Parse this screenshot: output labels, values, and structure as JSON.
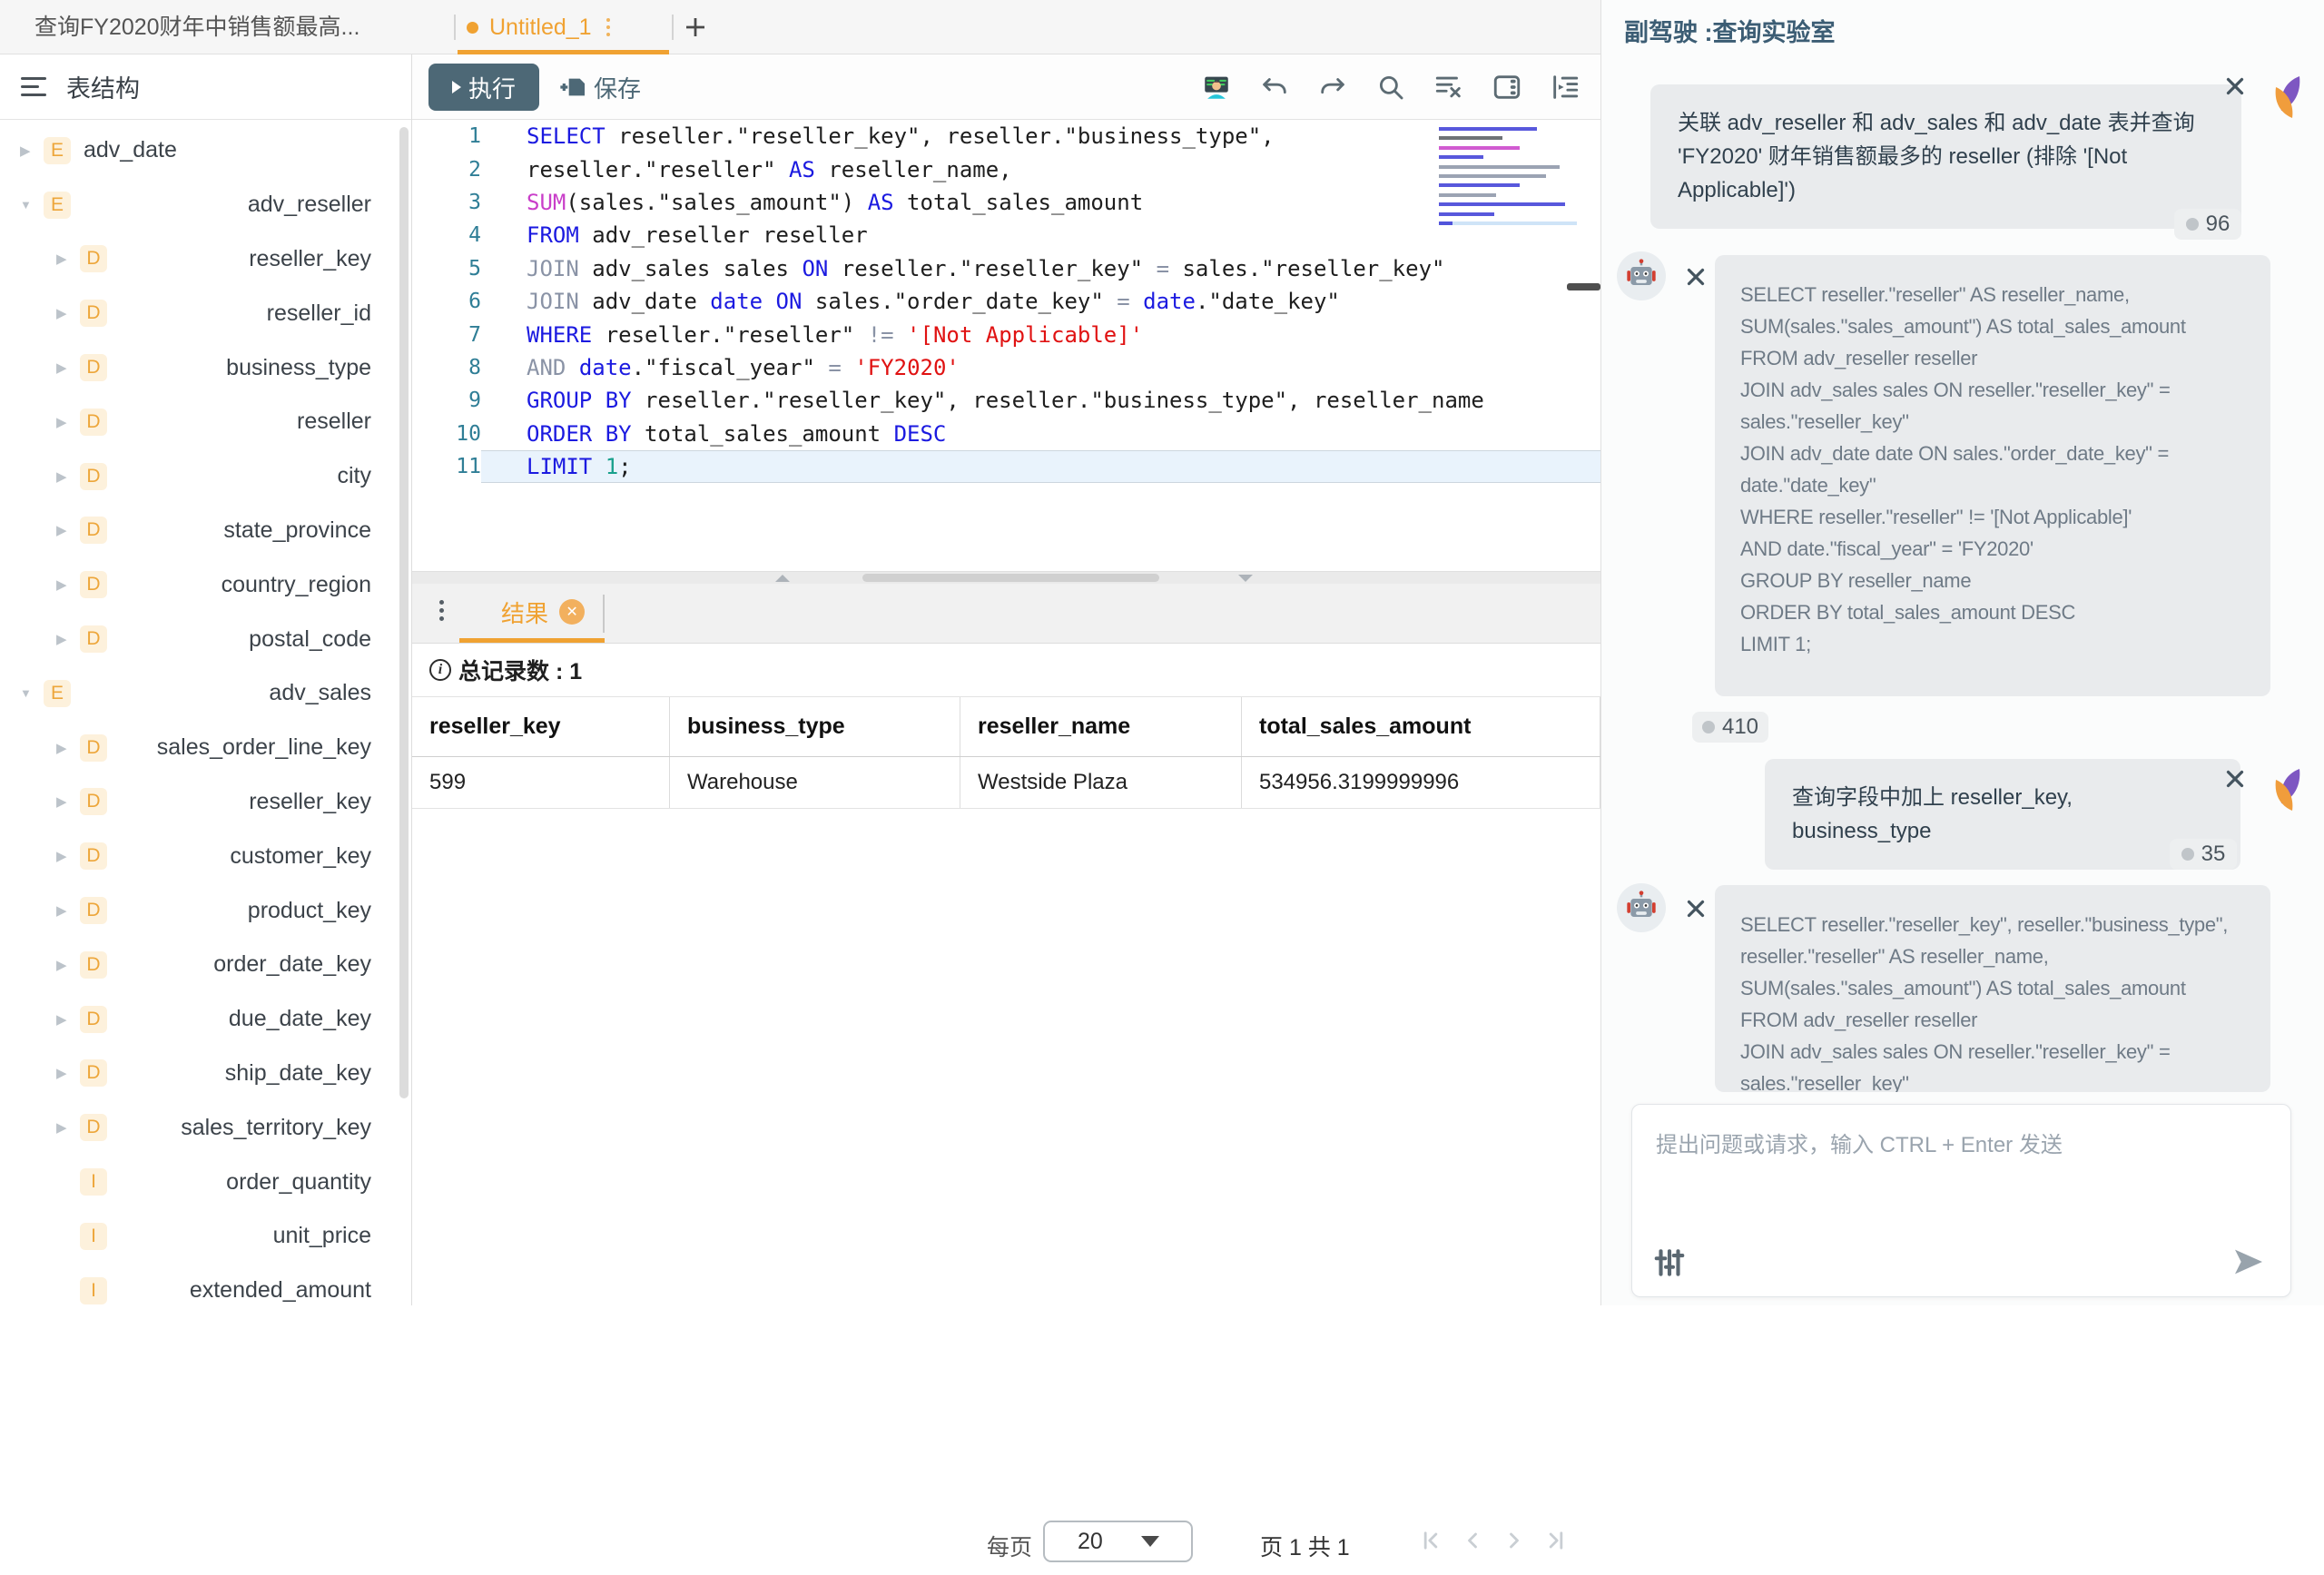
{
  "colors": {
    "accent_orange": "#f0a232",
    "slate": "#4d6876",
    "copilot_title": "#3c5d74",
    "syntax_keyword": "#1b1ae0",
    "syntax_secondary": "#8a93a6",
    "syntax_function": "#c93ec9",
    "syntax_string": "#e01212",
    "syntax_number": "#18a08c",
    "line_number": "#2f7e96"
  },
  "tabs": {
    "tab1_label": "查询FY2020财年中销售额最高...",
    "tab2_label": "Untitled_1",
    "new_tab_label": "+"
  },
  "sidebar": {
    "title": "表结构",
    "tree": [
      {
        "label": "adv_date",
        "badge": "E",
        "level": 0,
        "expanded": false,
        "align": "left",
        "arrow": true
      },
      {
        "label": "adv_reseller",
        "badge": "E",
        "level": 0,
        "expanded": true,
        "align": "right",
        "arrow": true
      },
      {
        "label": "reseller_key",
        "badge": "D",
        "level": 1,
        "arrow": true
      },
      {
        "label": "reseller_id",
        "badge": "D",
        "level": 1,
        "arrow": true
      },
      {
        "label": "business_type",
        "badge": "D",
        "level": 1,
        "arrow": true
      },
      {
        "label": "reseller",
        "badge": "D",
        "level": 1,
        "arrow": true
      },
      {
        "label": "city",
        "badge": "D",
        "level": 1,
        "arrow": true
      },
      {
        "label": "state_province",
        "badge": "D",
        "level": 1,
        "arrow": true
      },
      {
        "label": "country_region",
        "badge": "D",
        "level": 1,
        "arrow": true
      },
      {
        "label": "postal_code",
        "badge": "D",
        "level": 1,
        "arrow": true
      },
      {
        "label": "adv_sales",
        "badge": "E",
        "level": 0,
        "expanded": true,
        "align": "right",
        "arrow": true
      },
      {
        "label": "sales_order_line_key",
        "badge": "D",
        "level": 1,
        "arrow": true
      },
      {
        "label": "reseller_key",
        "badge": "D",
        "level": 1,
        "arrow": true
      },
      {
        "label": "customer_key",
        "badge": "D",
        "level": 1,
        "arrow": true
      },
      {
        "label": "product_key",
        "badge": "D",
        "level": 1,
        "arrow": true
      },
      {
        "label": "order_date_key",
        "badge": "D",
        "level": 1,
        "arrow": true
      },
      {
        "label": "due_date_key",
        "badge": "D",
        "level": 1,
        "arrow": true
      },
      {
        "label": "ship_date_key",
        "badge": "D",
        "level": 1,
        "arrow": true
      },
      {
        "label": "sales_territory_key",
        "badge": "D",
        "level": 1,
        "arrow": true
      },
      {
        "label": "order_quantity",
        "badge": "I",
        "level": 1,
        "arrow": false
      },
      {
        "label": "unit_price",
        "badge": "I",
        "level": 1,
        "arrow": false
      },
      {
        "label": "extended_amount",
        "badge": "I",
        "level": 1,
        "arrow": false
      }
    ]
  },
  "toolbar": {
    "run_label": "执行",
    "save_label": "保存",
    "icons": [
      "technologist-icon",
      "undo-icon",
      "redo-icon",
      "search-icon",
      "clear-format-icon",
      "panel-icon",
      "indent-icon"
    ]
  },
  "editor": {
    "lines": [
      {
        "num": "1",
        "segs": [
          [
            "kw",
            "SELECT"
          ],
          [
            "pl",
            " reseller.\"reseller_key\", reseller.\"business_type\","
          ]
        ]
      },
      {
        "num": "2",
        "segs": [
          [
            "pl",
            "reseller.\"reseller\" "
          ],
          [
            "kw",
            "AS"
          ],
          [
            "pl",
            " reseller_name,"
          ]
        ]
      },
      {
        "num": "3",
        "segs": [
          [
            "fn",
            "SUM"
          ],
          [
            "pl",
            "(sales.\"sales_amount\") "
          ],
          [
            "kw",
            "AS"
          ],
          [
            "pl",
            " total_sales_amount"
          ]
        ]
      },
      {
        "num": "4",
        "segs": [
          [
            "kw",
            "FROM"
          ],
          [
            "pl",
            " adv_reseller reseller"
          ]
        ]
      },
      {
        "num": "5",
        "segs": [
          [
            "kw2",
            "JOIN"
          ],
          [
            "pl",
            " adv_sales sales "
          ],
          [
            "kw",
            "ON"
          ],
          [
            "pl",
            " reseller.\"reseller_key\" "
          ],
          [
            "kw2",
            "="
          ],
          [
            "pl",
            " sales.\"reseller_key\""
          ]
        ]
      },
      {
        "num": "6",
        "segs": [
          [
            "kw2",
            "JOIN"
          ],
          [
            "pl",
            " adv_date "
          ],
          [
            "kw",
            "date"
          ],
          [
            "pl",
            " "
          ],
          [
            "kw",
            "ON"
          ],
          [
            "pl",
            " sales.\"order_date_key\" "
          ],
          [
            "kw2",
            "="
          ],
          [
            "pl",
            " "
          ],
          [
            "kw",
            "date"
          ],
          [
            "pl",
            ".\"date_key\""
          ]
        ]
      },
      {
        "num": "7",
        "segs": [
          [
            "kw",
            "WHERE"
          ],
          [
            "pl",
            " reseller.\"reseller\" "
          ],
          [
            "kw2",
            "!="
          ],
          [
            "pl",
            " "
          ],
          [
            "str",
            "'[Not Applicable]'"
          ]
        ]
      },
      {
        "num": "8",
        "segs": [
          [
            "kw2",
            "AND"
          ],
          [
            "pl",
            " "
          ],
          [
            "kw",
            "date"
          ],
          [
            "pl",
            ".\"fiscal_year\" "
          ],
          [
            "kw2",
            "="
          ],
          [
            "pl",
            " "
          ],
          [
            "str",
            "'FY2020'"
          ]
        ]
      },
      {
        "num": "9",
        "segs": [
          [
            "kw",
            "GROUP BY"
          ],
          [
            "pl",
            " reseller.\"reseller_key\", reseller.\"business_type\", reseller_name"
          ]
        ]
      },
      {
        "num": "10",
        "segs": [
          [
            "kw",
            "ORDER BY"
          ],
          [
            "pl",
            " total_sales_amount "
          ],
          [
            "kw",
            "DESC"
          ]
        ]
      },
      {
        "num": "11",
        "segs": [
          [
            "kw",
            "LIMIT"
          ],
          [
            "pl",
            " "
          ],
          [
            "num",
            "1"
          ],
          [
            "pl",
            ";"
          ]
        ],
        "current": true
      }
    ]
  },
  "results": {
    "tab_label": "结果",
    "total_label": "总记录数 : 1",
    "columns": [
      "reseller_key",
      "business_type",
      "reseller_name",
      "total_sales_amount"
    ],
    "rows": [
      [
        "599",
        "Warehouse",
        "Westside Plaza",
        "534956.3199999996"
      ]
    ]
  },
  "pagination": {
    "per_page_label": "每页",
    "per_page_value": "20",
    "page_info": "页 1 共 1",
    "nav_icons": [
      "first-page-icon",
      "prev-page-icon",
      "next-page-icon",
      "last-page-icon"
    ]
  },
  "copilot": {
    "title": "副驾驶 :查询实验室",
    "messages": [
      {
        "role": "user",
        "tokens": "96",
        "text": "关联 adv_reseller 和 adv_sales 和 adv_date 表并查询 'FY2020' 财年销售额最多的 reseller (排除 '[Not Applicable]')"
      },
      {
        "role": "assistant",
        "tokens": "410",
        "text": "SELECT reseller.\"reseller\" AS reseller_name,\nSUM(sales.\"sales_amount\") AS total_sales_amount\nFROM adv_reseller reseller\nJOIN adv_sales sales ON reseller.\"reseller_key\" = sales.\"reseller_key\"\nJOIN adv_date date ON sales.\"order_date_key\" = date.\"date_key\"\nWHERE reseller.\"reseller\" != '[Not Applicable]'\nAND date.\"fiscal_year\" = 'FY2020'\nGROUP BY reseller_name\nORDER BY total_sales_amount DESC\nLIMIT 1;"
      },
      {
        "role": "user",
        "tokens": "35",
        "text": "查询字段中加上 reseller_key, business_type"
      },
      {
        "role": "assistant",
        "tokens": null,
        "text": "SELECT reseller.\"reseller_key\", reseller.\"business_type\",\nreseller.\"reseller\" AS reseller_name,\nSUM(sales.\"sales_amount\") AS total_sales_amount\nFROM adv_reseller reseller\nJOIN adv_sales sales ON reseller.\"reseller_key\" = sales.\"reseller_key\""
      }
    ],
    "input_placeholder": "提出问题或请求，输入 CTRL + Enter 发送"
  }
}
